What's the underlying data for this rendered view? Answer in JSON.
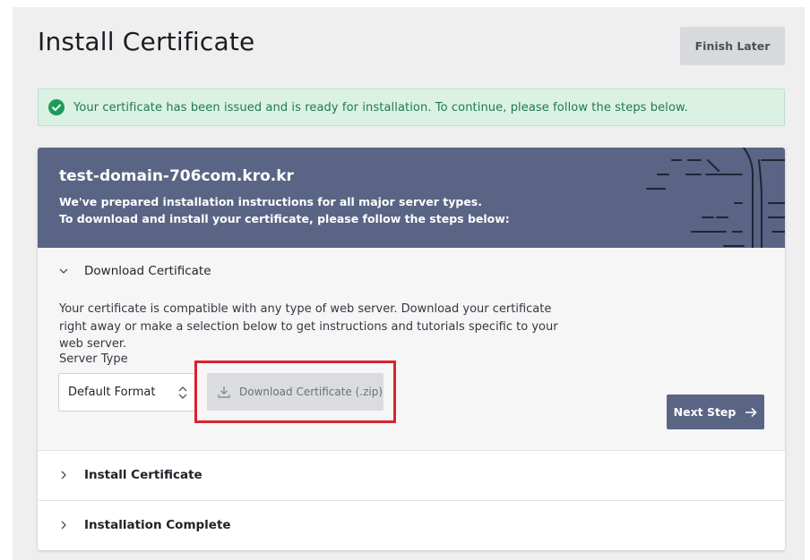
{
  "page": {
    "title": "Install Certificate",
    "finish_later": "Finish Later"
  },
  "alert": {
    "icon": "check-circle-icon",
    "text": "Your certificate has been issued and is ready for installation. To continue, please follow the steps below.",
    "color": "#1f7a4b"
  },
  "card": {
    "domain": "test-domain-706com.kro.kr",
    "line1": "We've prepared installation instructions for all major server types.",
    "line2": "To download and install your certificate, please follow the steps below:",
    "header_color": "#5a6585"
  },
  "steps": [
    {
      "title": "Download Certificate",
      "expanded": true,
      "description": "Your certificate is compatible with any type of web server. Download your certificate right away or make a selection below to get instructions and tutorials specific to your web server.",
      "server_type_label": "Server Type",
      "server_type_value": "Default Format",
      "download_label": "Download Certificate (.zip)",
      "next_label": "Next Step"
    },
    {
      "title": "Install Certificate",
      "expanded": false
    },
    {
      "title": "Installation Complete",
      "expanded": false
    }
  ],
  "highlight_color": "#d9232e"
}
